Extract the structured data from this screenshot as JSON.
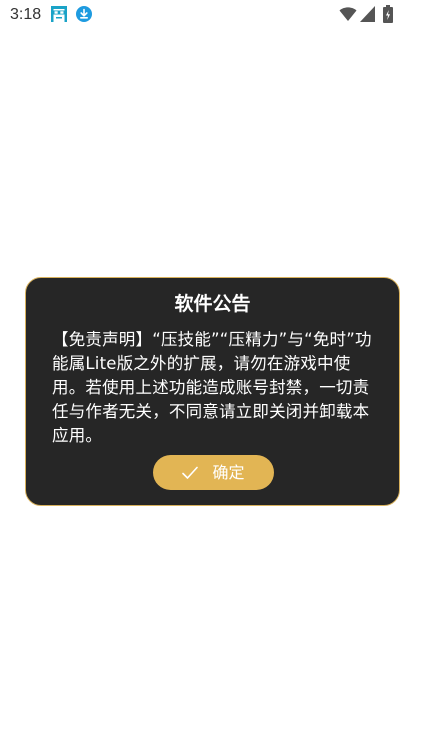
{
  "status_bar": {
    "time": "3:18",
    "icons": [
      "app-notification-icon",
      "download-icon",
      "wifi-icon",
      "signal-icon",
      "battery-icon"
    ]
  },
  "dialog": {
    "title": "软件公告",
    "body": "【免责声明】“压技能”“压精力”与“免时”功能属Lite版之外的扩展，请勿在游戏中使用。若使用上述功能造成账号封禁，一切责任与作者无关，不同意请立即关闭并卸载本应用。",
    "confirm_label": "确定",
    "confirm_icon": "check-icon"
  },
  "colors": {
    "dialog_background": "#262626",
    "dialog_border": "#d8b15c",
    "button_background": "#e2b554",
    "status_icon_teal": "#1aa3c7",
    "background": "#ffffff"
  }
}
